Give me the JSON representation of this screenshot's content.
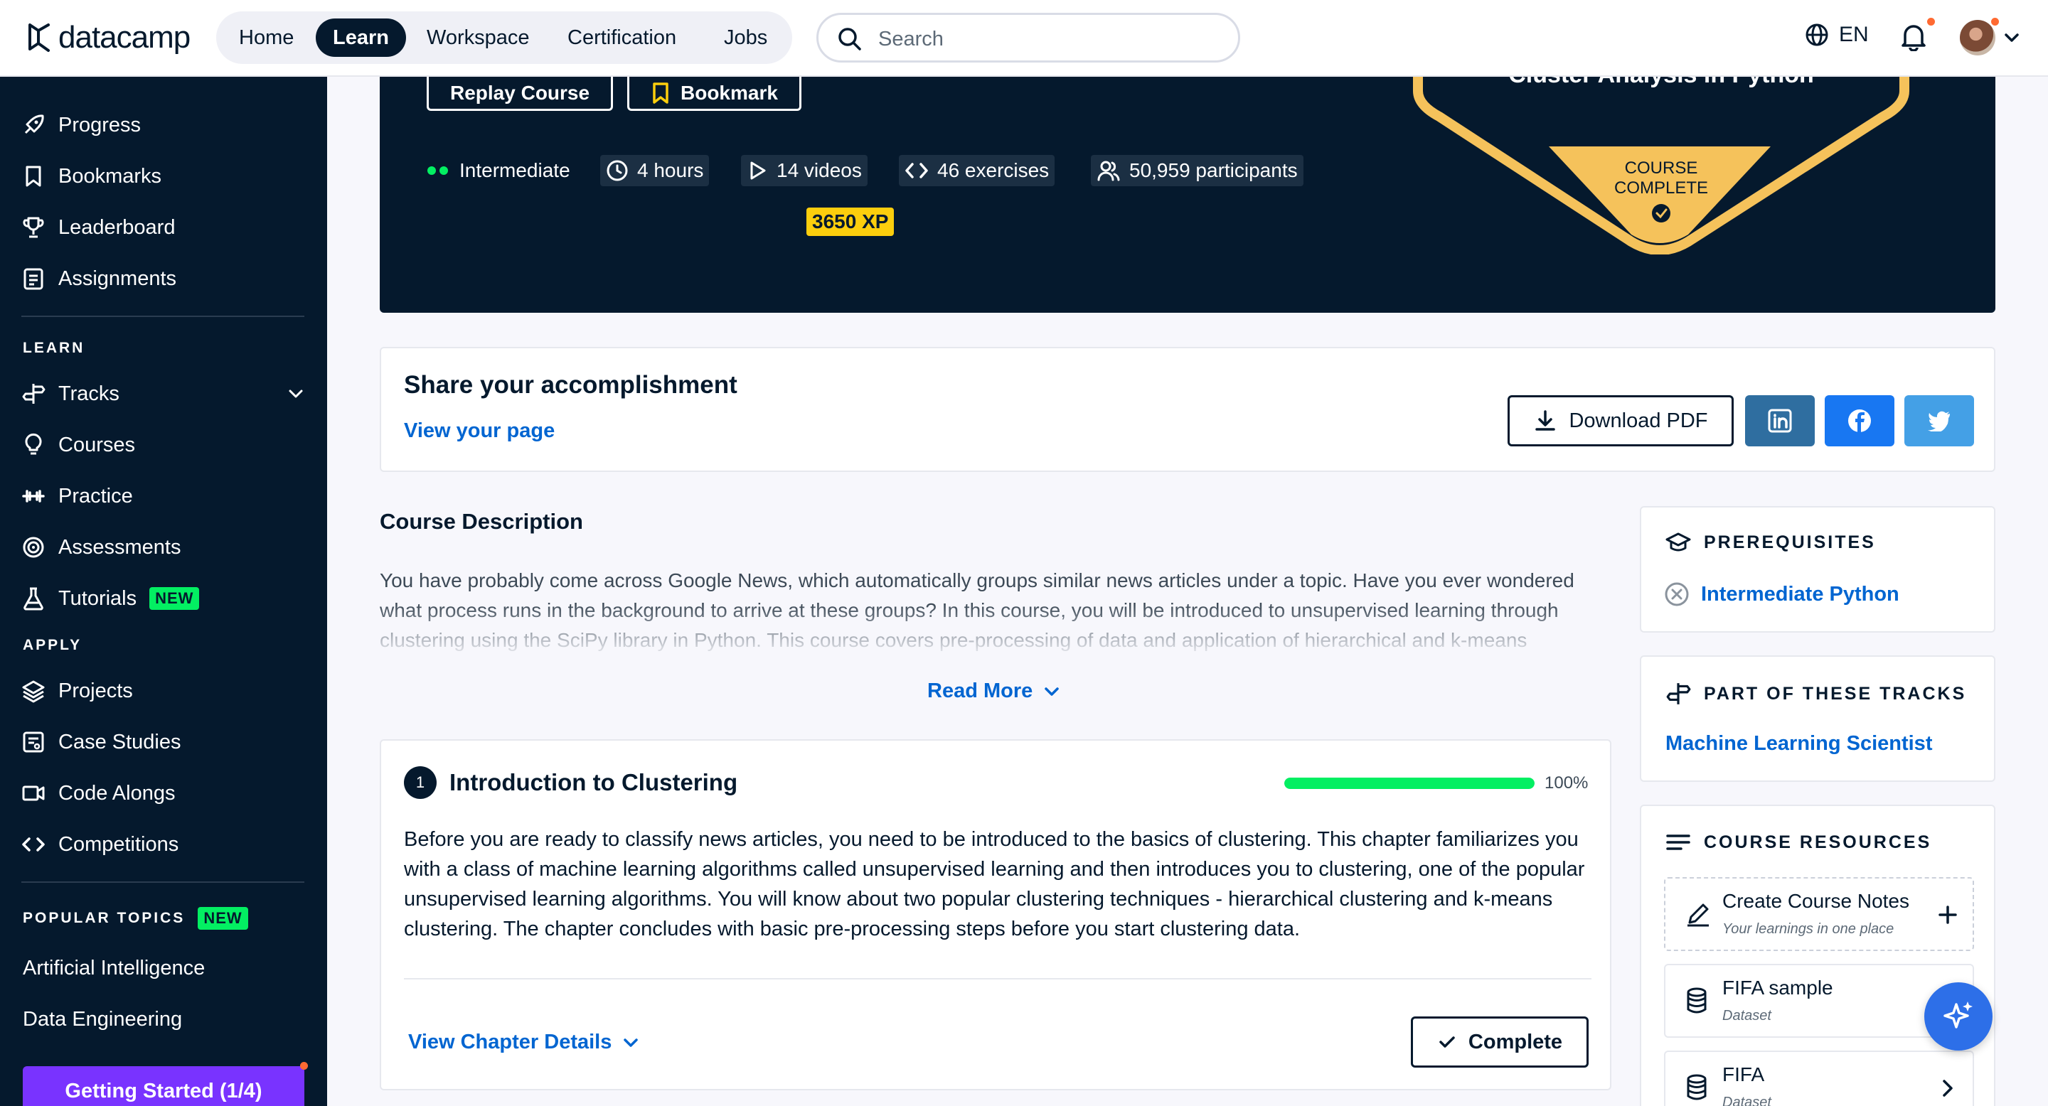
{
  "topbar": {
    "logo": "datacamp",
    "nav": [
      "Home",
      "Learn",
      "Workspace",
      "Certification",
      "Jobs"
    ],
    "active_nav": "Learn",
    "search_placeholder": "Search",
    "language": "EN"
  },
  "sidebar": {
    "top_items": [
      "Progress",
      "Bookmarks",
      "Leaderboard",
      "Assignments"
    ],
    "learn_heading": "LEARN",
    "learn_items": [
      "Tracks",
      "Courses",
      "Practice",
      "Assessments",
      "Tutorials"
    ],
    "new_badge": "NEW",
    "apply_heading": "APPLY",
    "apply_items": [
      "Projects",
      "Case Studies",
      "Code Alongs",
      "Competitions"
    ],
    "topics_heading": "POPULAR TOPICS",
    "topics": [
      "Artificial Intelligence",
      "Data Engineering"
    ],
    "getting_started": "Getting Started (1/4)"
  },
  "hero": {
    "replay_button": "Replay Course",
    "bookmark_button": "Bookmark",
    "level": "Intermediate",
    "duration": "4 hours",
    "videos": "14 videos",
    "exercises": "46 exercises",
    "participants": "50,959 participants",
    "xp": "3650 XP",
    "badge_title": "Cluster Analysis in Python",
    "badge_status_line1": "COURSE",
    "badge_status_line2": "COMPLETE"
  },
  "share": {
    "title": "Share your accomplishment",
    "link": "View your page",
    "download": "Download PDF",
    "colors": {
      "linkedin": "#2f6ea0",
      "facebook": "#1877f2",
      "twitter": "#44a0e6"
    }
  },
  "description": {
    "title": "Course Description",
    "text": "You have probably come across Google News, which automatically groups similar news articles under a topic. Have you ever wondered what process runs in the background to arrive at these groups? In this course, you will be introduced to unsupervised learning through clustering using the SciPy library in Python. This course covers pre-processing of data and application of hierarchical and k-means clustering. Through the course, you will explore player statistics from a popular football video game, FIFA",
    "read_more": "Read More"
  },
  "chapter": {
    "number": "1",
    "title": "Introduction to Clustering",
    "progress": 1.0,
    "progress_label": "100%",
    "text": "Before you are ready to classify news articles, you need to be introduced to the basics of clustering. This chapter familiarizes you with a class of machine learning algorithms called unsupervised learning and then introduces you to clustering, one of the popular unsupervised learning algorithms. You will know about two popular clustering techniques - hierarchical clustering and k-means clustering. The chapter concludes with basic pre-processing steps before you start clustering data.",
    "details_link": "View Chapter Details",
    "complete_button": "Complete"
  },
  "prerequisites": {
    "title": "PREREQUISITES",
    "item": "Intermediate Python"
  },
  "tracks": {
    "title": "PART OF THESE TRACKS",
    "item": "Machine Learning Scientist"
  },
  "resources": {
    "title": "COURSE RESOURCES",
    "items": [
      {
        "name": "Create Course Notes",
        "sub": "Your learnings in one place"
      },
      {
        "name": "FIFA sample",
        "sub": "Dataset"
      },
      {
        "name": "FIFA",
        "sub": "Dataset"
      }
    ]
  }
}
